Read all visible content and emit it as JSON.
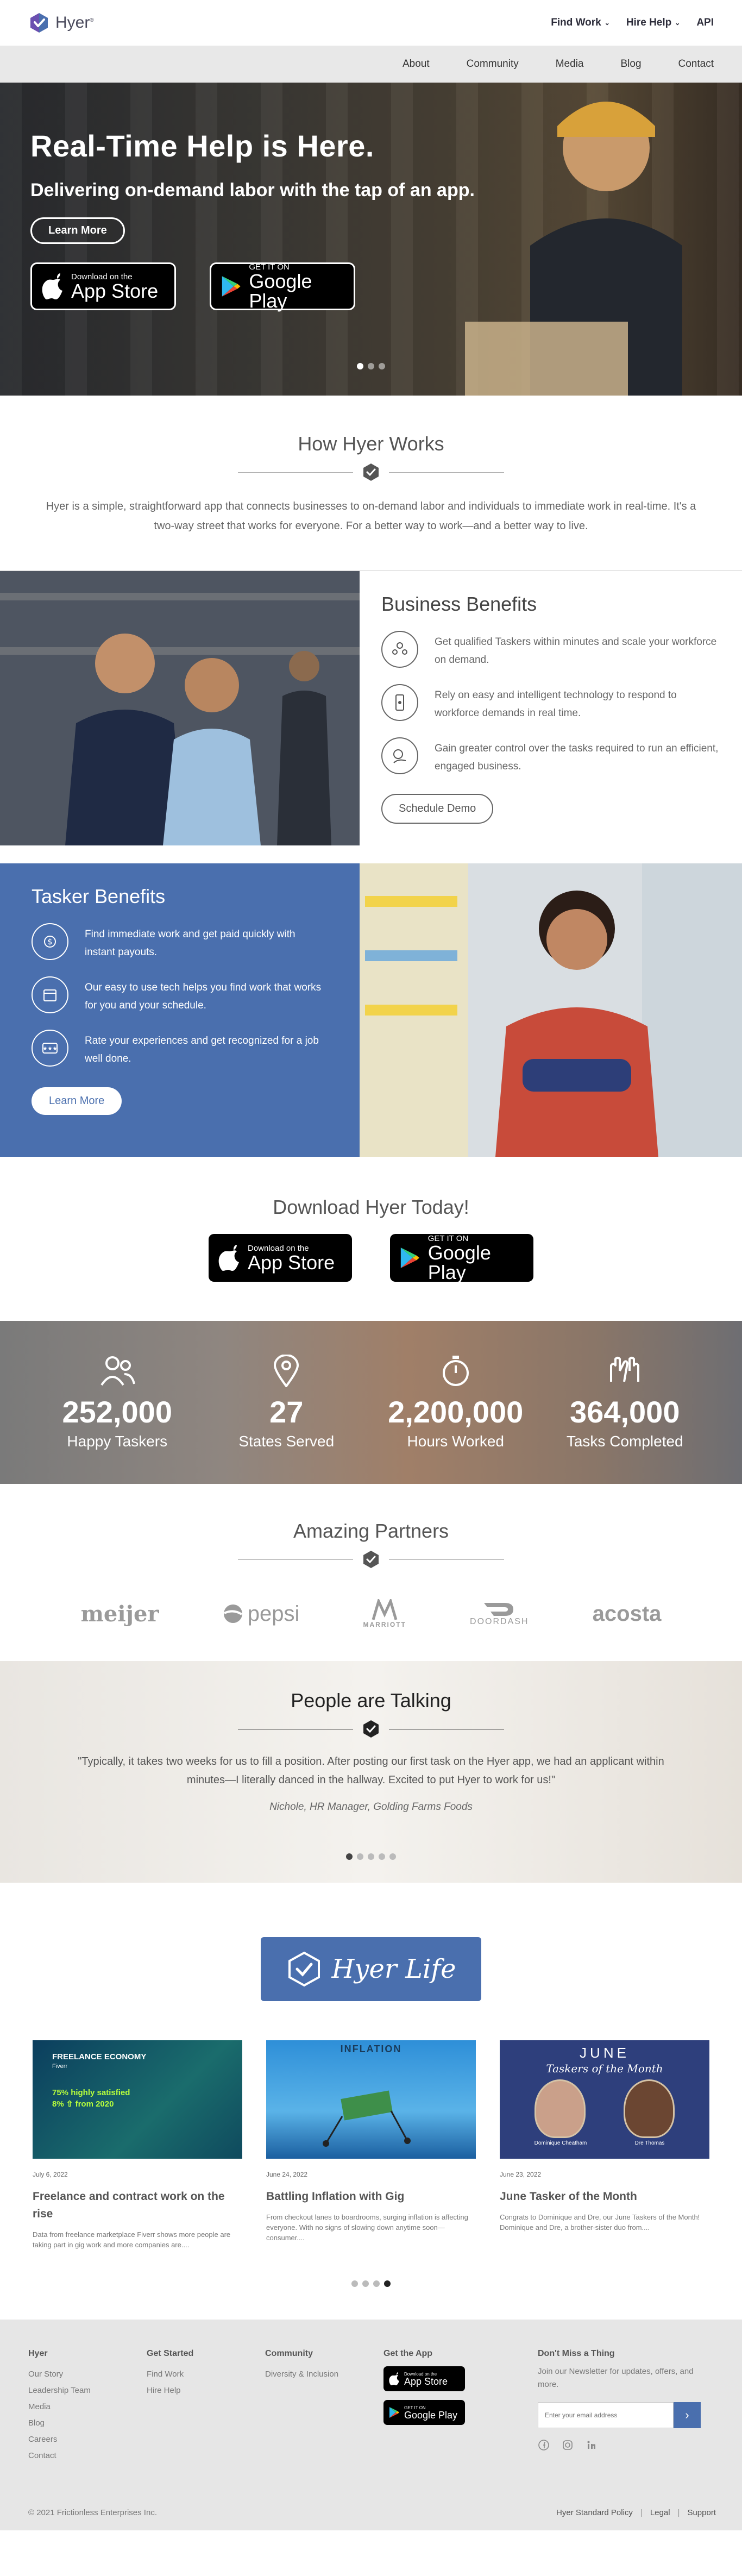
{
  "brand": {
    "name": "Hyer",
    "mark": "®",
    "accent": "#4a6fae",
    "logo_color": "#6a4fb0"
  },
  "topnav": {
    "find_work": "Find Work",
    "hire_help": "Hire Help",
    "api": "API"
  },
  "subnav": [
    "About",
    "Community",
    "Media",
    "Blog",
    "Contact"
  ],
  "hero": {
    "title": "Real-Time Help is Here.",
    "subtitle": "Delivering on-demand labor with the tap of an app.",
    "cta": "Learn More",
    "app_store_small": "Download on the",
    "app_store_big": "App Store",
    "play_small": "GET IT ON",
    "play_big": "Google Play",
    "slides": 3,
    "active_slide": 1
  },
  "how": {
    "title": "How Hyer Works",
    "text": "Hyer is a simple, straightforward app that connects businesses to on-demand labor and individuals to immediate work in real-time. It's a two-way street that works for everyone. For a better way to work—and a better way to live."
  },
  "business": {
    "title": "Business Benefits",
    "items": [
      {
        "icon": "people-icon",
        "text": "Get qualified Taskers within minutes and scale your workforce on demand."
      },
      {
        "icon": "phone-icon",
        "text": "Rely on easy and intelligent technology to respond to workforce demands in real time."
      },
      {
        "icon": "control-icon",
        "text": "Gain greater control over the tasks required to run an efficient, engaged business."
      }
    ],
    "cta": "Schedule Demo"
  },
  "tasker": {
    "title": "Tasker Benefits",
    "items": [
      {
        "icon": "dollar-icon",
        "text": "Find immediate work and get paid quickly with instant payouts."
      },
      {
        "icon": "calendar-icon",
        "text": "Our easy to use tech helps you find work that works for you and your schedule."
      },
      {
        "icon": "rating-icon",
        "text": "Rate your experiences and get recognized for a job well done."
      }
    ],
    "cta": "Learn More"
  },
  "download": {
    "title": "Download Hyer Today!"
  },
  "stats": [
    {
      "icon": "people-icon",
      "value": "252,000",
      "label": "Happy Taskers"
    },
    {
      "icon": "location-pin-icon",
      "value": "27",
      "label": "States Served"
    },
    {
      "icon": "stopwatch-icon",
      "value": "2,200,000",
      "label": "Hours Worked"
    },
    {
      "icon": "high-five-icon",
      "value": "364,000",
      "label": "Tasks Completed"
    }
  ],
  "partners": {
    "title": "Amazing Partners",
    "logos": [
      "meijer",
      "pepsi",
      "MARRIOTT",
      "DOORDASH",
      "acosta"
    ]
  },
  "talk": {
    "title": "People are Talking",
    "quote": "\"Typically, it takes two weeks for us to fill a position. After posting our first task on the Hyer app, we had an applicant within minutes—I literally danced in the hallway. Excited to put Hyer to work for us!\"",
    "author": "Nichole, HR Manager, Golding Farms Foods",
    "slides": 5,
    "active_slide": 0
  },
  "life": {
    "title": "Hyer Life",
    "cards": [
      {
        "img_tag": "FREELANCE ECONOMY",
        "img_sub": "Fiverr",
        "img_stat1": "75% highly satisfied",
        "img_stat2": "8% ⇧ from 2020",
        "date": "July 6, 2022",
        "title": "Freelance and contract work on the rise",
        "excerpt": "Data from freelance marketplace Fiverr shows more people are taking part in gig work and more companies are...."
      },
      {
        "img_tag": "INFLATION",
        "date": "June 24, 2022",
        "title": "Battling Inflation with Gig",
        "excerpt": "From checkout lanes to boardrooms, surging inflation is affecting everyone. With no signs of slowing down anytime soon—consumer...."
      },
      {
        "img_tag": "JUNE",
        "img_script": "Taskers of the Month",
        "name1": "Dominique Cheatham",
        "name2": "Dre Thomas",
        "date": "June 23, 2022",
        "title": "June Tasker of the Month",
        "excerpt": "Congrats to Dominique and Dre, our June Taskers of the Month! Dominique and Dre, a brother-sister duo from...."
      }
    ],
    "slides": 4,
    "active_slide": 3
  },
  "footer": {
    "col_hyer": {
      "title": "Hyer",
      "links": [
        "Our Story",
        "Leadership Team",
        "Media",
        "Blog",
        "Careers",
        "Contact"
      ]
    },
    "col_started": {
      "title": "Get Started",
      "links": [
        "Find Work",
        "Hire Help"
      ]
    },
    "col_community": {
      "title": "Community",
      "links": [
        "Diversity & Inclusion"
      ]
    },
    "col_app": {
      "title": "Get the App"
    },
    "newsletter": {
      "title": "Don't Miss a Thing",
      "text": "Join our Newsletter for updates, offers, and more.",
      "placeholder": "Enter your email address"
    },
    "copyright": "© 2021 Frictionless Enterprises Inc.",
    "legal": [
      "Hyer Standard Policy",
      "Legal",
      "Support"
    ]
  }
}
